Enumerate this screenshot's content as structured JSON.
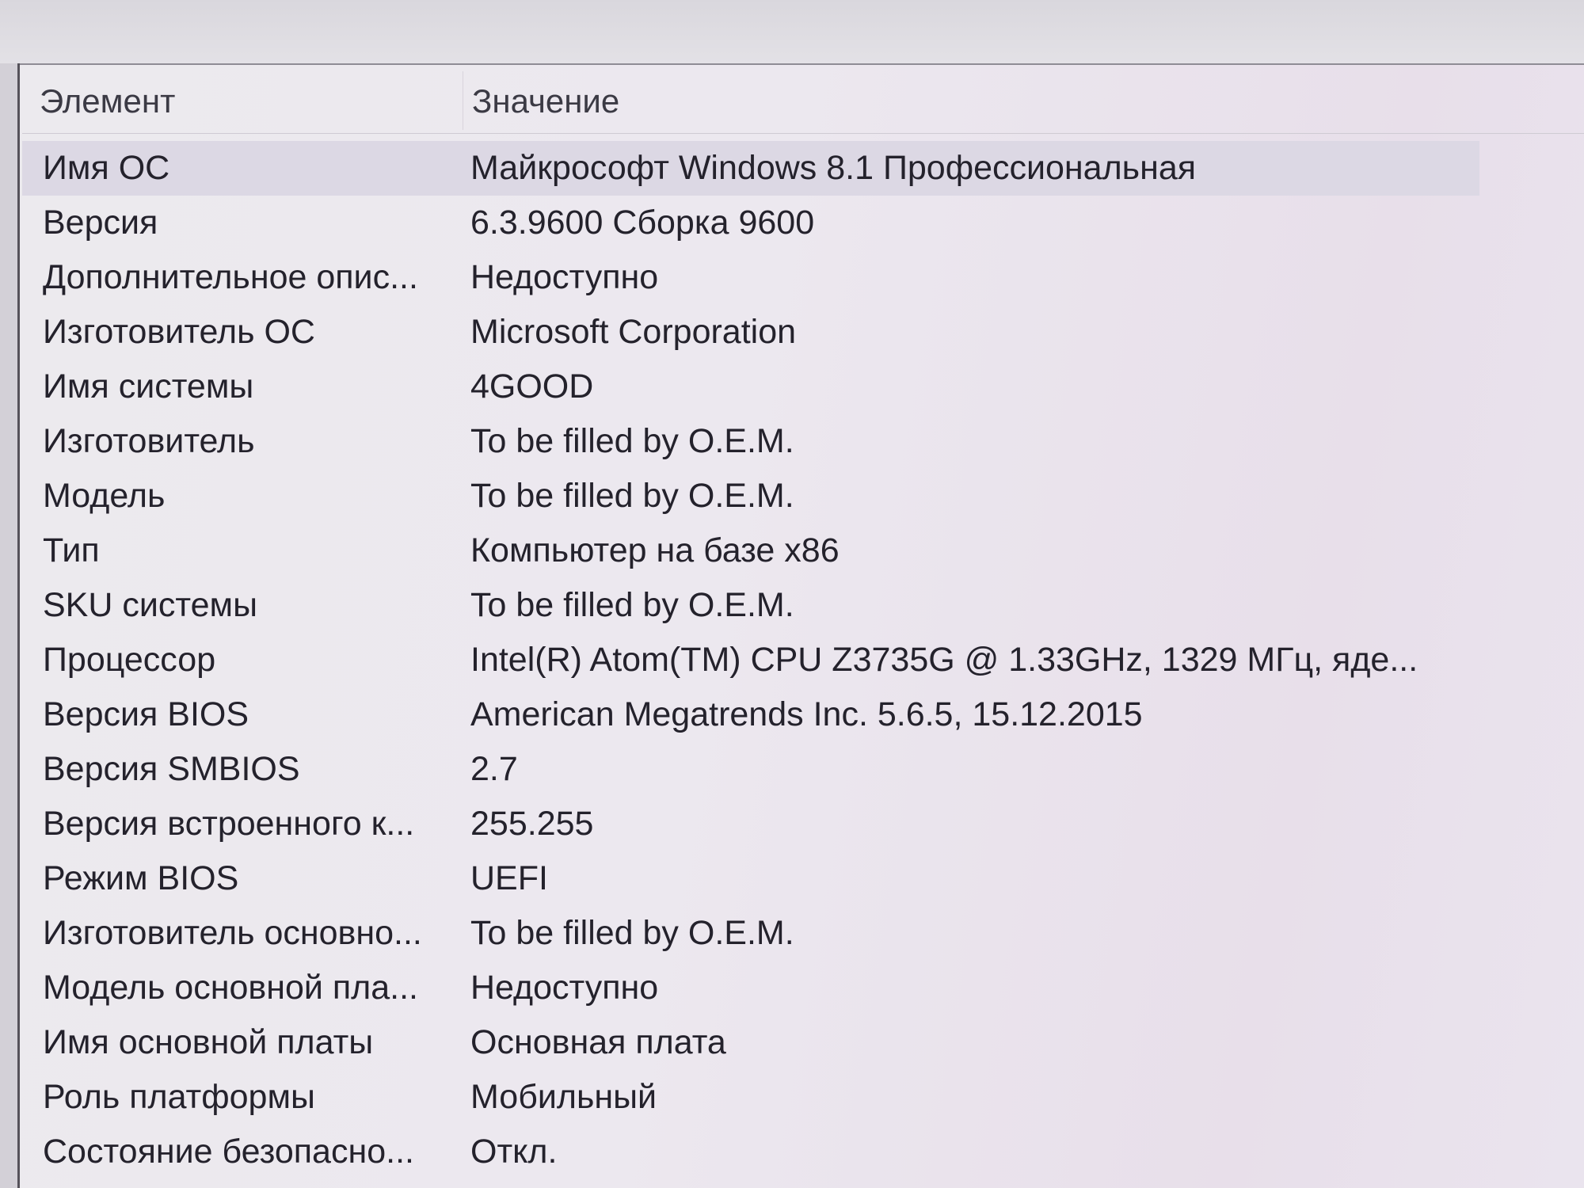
{
  "columns": {
    "element": "Элемент",
    "value": "Значение"
  },
  "rows": [
    {
      "name": "Имя ОС",
      "value": "Майкрософт Windows 8.1 Профессиональная"
    },
    {
      "name": "Версия",
      "value": "6.3.9600 Сборка 9600"
    },
    {
      "name": "Дополнительное опис...",
      "value": "Недоступно"
    },
    {
      "name": "Изготовитель ОС",
      "value": "Microsoft Corporation"
    },
    {
      "name": "Имя системы",
      "value": "4GOOD"
    },
    {
      "name": "Изготовитель",
      "value": "To be filled by O.E.M."
    },
    {
      "name": "Модель",
      "value": "To be filled by O.E.M."
    },
    {
      "name": "Тип",
      "value": "Компьютер на базе x86"
    },
    {
      "name": "SKU системы",
      "value": "To be filled by O.E.M."
    },
    {
      "name": "Процессор",
      "value": "Intel(R) Atom(TM) CPU  Z3735G @ 1.33GHz, 1329 МГц, яде..."
    },
    {
      "name": "Версия BIOS",
      "value": "American Megatrends Inc. 5.6.5, 15.12.2015"
    },
    {
      "name": "Версия SMBIOS",
      "value": "2.7"
    },
    {
      "name": "Версия встроенного к...",
      "value": "255.255"
    },
    {
      "name": "Режим BIOS",
      "value": "UEFI"
    },
    {
      "name": "Изготовитель основно...",
      "value": "To be filled by O.E.M."
    },
    {
      "name": "Модель основной пла...",
      "value": "Недоступно"
    },
    {
      "name": "Имя основной платы",
      "value": "Основная плата"
    },
    {
      "name": "Роль платформы",
      "value": "Мобильный"
    },
    {
      "name": "Состояние безопасно...",
      "value": "Откл."
    }
  ]
}
